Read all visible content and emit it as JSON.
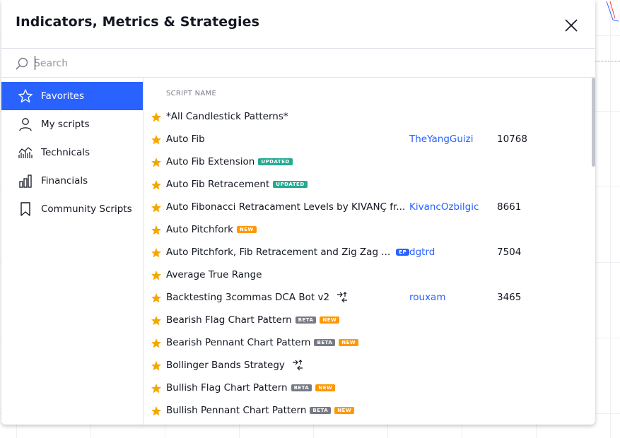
{
  "dialog": {
    "title": "Indicators, Metrics & Strategies"
  },
  "search": {
    "placeholder": "Search",
    "value": ""
  },
  "sidebar": {
    "items": [
      {
        "label": "Favorites",
        "icon": "star-outline-icon",
        "active": true
      },
      {
        "label": "My scripts",
        "icon": "user-icon",
        "active": false
      },
      {
        "label": "Technicals",
        "icon": "chart-bars-icon",
        "active": false
      },
      {
        "label": "Financials",
        "icon": "financials-icon",
        "active": false
      },
      {
        "label": "Community Scripts",
        "icon": "bookmark-icon",
        "active": false
      }
    ]
  },
  "list": {
    "column_header": "SCRIPT NAME",
    "rows": [
      {
        "name": "*All Candlestick Patterns*",
        "author": "",
        "count": "",
        "badges": [],
        "strategy": false
      },
      {
        "name": "Auto Fib",
        "author": "TheYangGuizi",
        "count": "10768",
        "badges": [],
        "strategy": false
      },
      {
        "name": "Auto Fib Extension",
        "author": "",
        "count": "",
        "badges": [
          "UPDATED"
        ],
        "strategy": false
      },
      {
        "name": "Auto Fib Retracement",
        "author": "",
        "count": "",
        "badges": [
          "UPDATED"
        ],
        "strategy": false
      },
      {
        "name": "Auto Fibonacci Retracament Levels by KIVANÇ fr...",
        "author": "KivancOzbilgic",
        "count": "8661",
        "badges": [],
        "strategy": false
      },
      {
        "name": "Auto Pitchfork",
        "author": "",
        "count": "",
        "badges": [
          "NEW"
        ],
        "strategy": false
      },
      {
        "name": "Auto Pitchfork, Fib Retracement and Zig Zag ...",
        "author": "dgtrd",
        "count": "7504",
        "badges": [
          "EP"
        ],
        "strategy": false
      },
      {
        "name": "Average True Range",
        "author": "",
        "count": "",
        "badges": [],
        "strategy": false
      },
      {
        "name": "Backtesting 3commas DCA Bot v2",
        "author": "rouxam",
        "count": "3465",
        "badges": [],
        "strategy": true
      },
      {
        "name": "Bearish Flag Chart Pattern",
        "author": "",
        "count": "",
        "badges": [
          "BETA",
          "NEW"
        ],
        "strategy": false
      },
      {
        "name": "Bearish Pennant Chart Pattern",
        "author": "",
        "count": "",
        "badges": [
          "BETA",
          "NEW"
        ],
        "strategy": false
      },
      {
        "name": "Bollinger Bands Strategy",
        "author": "",
        "count": "",
        "badges": [],
        "strategy": true
      },
      {
        "name": "Bullish Flag Chart Pattern",
        "author": "",
        "count": "",
        "badges": [
          "BETA",
          "NEW"
        ],
        "strategy": false
      },
      {
        "name": "Bullish Pennant Chart Pattern",
        "author": "",
        "count": "",
        "badges": [
          "BETA",
          "NEW"
        ],
        "strategy": false
      }
    ]
  },
  "colors": {
    "accent": "#2962ff",
    "star": "#f7a600",
    "updated_badge": "#22ab94",
    "new_badge": "#ff9800",
    "beta_badge": "#787b86"
  }
}
